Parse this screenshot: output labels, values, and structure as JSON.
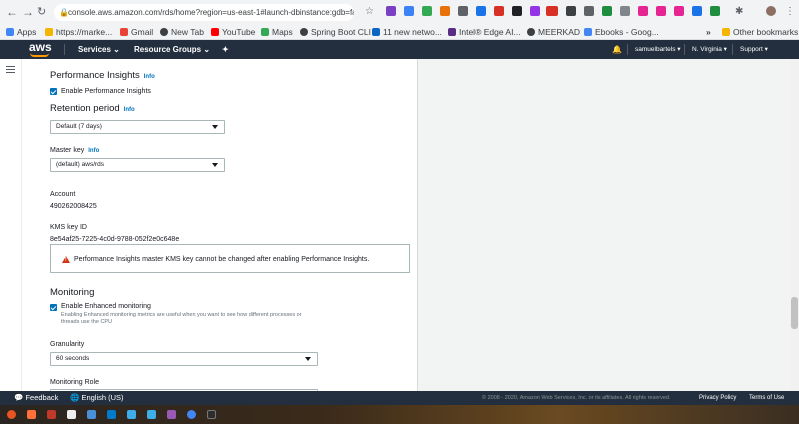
{
  "browser": {
    "url": "console.aws.amazon.com/rds/home?region=us-east-1#launch-dbinstance:gdb=false;...",
    "bookmarks": [
      "Apps",
      "https://marke...",
      "Gmail",
      "New Tab",
      "YouTube",
      "Maps",
      "Spring Boot CLI",
      "11 new netwo...",
      "Intel® Edge AI...",
      "MEERKAD",
      "Ebooks - Goog..."
    ],
    "other_bookmarks": "Other bookmarks",
    "overflow": "»"
  },
  "aws_header": {
    "logo": "aws",
    "services": "Services",
    "resource_groups": "Resource Groups",
    "user": "samuelbartels",
    "region": "N. Virginia",
    "support": "Support"
  },
  "form": {
    "performance_insights": {
      "title": "Performance Insights",
      "info": "Info",
      "enable_label": "Enable Performance Insights",
      "enabled": true
    },
    "retention": {
      "title": "Retention period",
      "info": "Info",
      "value": "Default (7 days)"
    },
    "master_key": {
      "label": "Master key",
      "info": "Info",
      "value": "(default) aws/rds"
    },
    "account": {
      "label": "Account",
      "value": "490262008425"
    },
    "kms_key": {
      "label": "KMS key ID",
      "value": "8e54af25-7225-4c0d-9788-052f2e0c648e"
    },
    "alert": {
      "message": "Performance Insights master KMS key cannot be changed after enabling Performance Insights."
    },
    "monitoring": {
      "title": "Monitoring",
      "enable_label": "Enable Enhanced monitoring",
      "enabled": true,
      "hint": "Enabling Enhanced monitoring metrics are useful when you want to see how different processes or threads use the CPU",
      "granularity_label": "Granularity",
      "granularity_value": "60 seconds",
      "role_label": "Monitoring Role"
    }
  },
  "footer": {
    "feedback": "Feedback",
    "language": "English (US)",
    "copyright": "© 2008 - 2020, Amazon Web Services, Inc. or its affiliates. All rights reserved.",
    "privacy": "Privacy Policy",
    "terms": "Terms of Use"
  },
  "colors": {
    "aws_header": "#232f3e",
    "aws_orange": "#ff9900",
    "link_blue": "#0073bb",
    "warning_red": "#d13212"
  }
}
